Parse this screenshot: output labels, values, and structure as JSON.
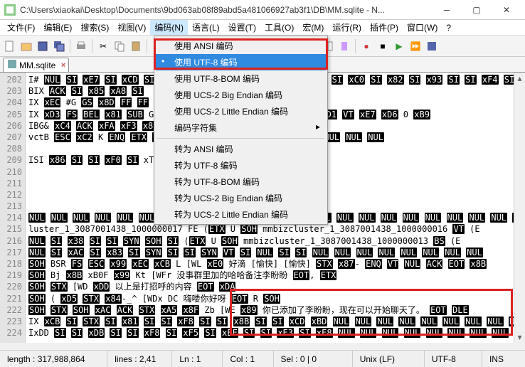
{
  "window": {
    "title": "C:\\Users\\xiaokai\\Desktop\\Documents\\9bd063ab08f89abd5a481066927ab3f1\\DB\\MM.sqlite - N..."
  },
  "menubar": {
    "items": [
      {
        "label": "文件(F)"
      },
      {
        "label": "编辑(E)"
      },
      {
        "label": "搜索(S)"
      },
      {
        "label": "视图(V)"
      },
      {
        "label": "编码(N)"
      },
      {
        "label": "语言(L)"
      },
      {
        "label": "设置(T)"
      },
      {
        "label": "工具(O)"
      },
      {
        "label": "宏(M)"
      },
      {
        "label": "运行(R)"
      },
      {
        "label": "插件(P)"
      },
      {
        "label": "窗口(W)"
      },
      {
        "label": "?"
      }
    ],
    "active_index": 4
  },
  "tab": {
    "label": "MM.sqlite"
  },
  "dropdown": {
    "groups": [
      [
        {
          "label": "使用 ANSI 编码"
        },
        {
          "label": "使用 UTF-8 编码",
          "selected": true,
          "bullet": true
        },
        {
          "label": "使用 UTF-8-BOM 编码"
        },
        {
          "label": "使用 UCS-2 Big Endian 编码"
        },
        {
          "label": "使用 UCS-2 Little Endian 编码"
        },
        {
          "label": "编码字符集",
          "submenu": true
        }
      ],
      [
        {
          "label": "转为 ANSI 编码"
        },
        {
          "label": "转为 UTF-8 编码"
        },
        {
          "label": "转为 UTF-8-BOM 编码"
        },
        {
          "label": "转为 UCS-2 Big Endian 编码"
        },
        {
          "label": "转为 UCS-2 Little Endian 编码"
        }
      ]
    ]
  },
  "gutter": {
    "start": 202,
    "end": 224
  },
  "code_lines": [
    "I# NUL SI xE7 SI xCD SI xE5 SI NUL NUL ETX NUL NUL NUL SI xC0 SI x82 SI x93 SI SI xF4 SI SI",
    "BIX ACK SI x85 xA8 SI                                              ",
    "IX xEC #G GS x8D FF FF ETB                                     ETX ACK SOH M% xF0 OPv xC1x",
    "IX xD3 FS BEL x81 SUB G                                    NUL FB FS FETX ETX ACK SOH Xi xD1 VT xE7 xD6 0 xB9",
    "IBG& xC4 ACK xFA xF3 x8D                                                                  ",
    "   vctB ESC xC2 K ENQ                                        ETX NUL NUL SI xFB NUL NUL NUL NUL NUL NUL NUL",
    "",
    "ISI x86 SI SI xF0 SI xTZ                                                                  ",
    "",
    "",
    "",
    "",
    "NUL NUL NUL NUL NUL NUL NUL NUL NUL NUL NUL NUL NUL NUL NUL NUL NUL NUL NUL NUL NUL NUL NUL NUL NUL NUL NUL",
    "luster_1_3087001438_1000000017 FE (ETX U SOH mmbizcluster_1_3087001438_1000000016 VT (E",
    "NUL SI x38 SI SI SYN SOH SI     (ETX U SOH mmbizcluster_1_3087001438_1000000013 BS (E",
    "NUL SI xAC SI x83 SI SYN SI SI SYN VT SI            NUL SI SI NUL NUL NUL NUL NUL NUL NUL NUL",
    "SOH        BSR FS ESC x99 xEC xCB L [WL xE0 好滴 [愉快] [愉快]  STX x87- ENQ VT     NUL ACK EOT x8B",
    "SOH           Bj x8B xB0F x99 Kt [WFr 没事群里加的哈哈备注李盼盼 EOT, ETX",
    "SOH   STX [WD xDD 以上是打招呼的内容 EOT xDA                                    ",
    "SOH         ( xD5 STX x84-_^ [WDx DC 嗨喽你好呀 EOT R SOH                        ",
    "SOH   STX SOH xAC ACK STX xA5 x8F Zb [WE x89 你已添加了李盼盼，现在可以开始聊天了。 EOT  DLE",
    "IX xCB SI STX SI x81 SI SI xF8 SI SI x8B SI SI xCD xBD NUL NUL NUL NUL NUL NUL NUL NUL NUL NUL NUL NUL NUL NUL NUL",
    "IxDD SI SI xDB SI SI xF8 SI xF5 SI xEF SI SI xE3 SI   xE8 NUL NUL NUL NUL NUL NUL NUL NUL NUL NUL NUL NUL NUL NUL NUL NUL"
  ],
  "statusbar": {
    "length": "length : 317,988,864",
    "lines": "lines : 2,41",
    "ln": "Ln : 1",
    "col": "Col : 1",
    "sel": "Sel : 0 | 0",
    "eol": "Unix (LF)",
    "enc": "UTF-8",
    "ins": "INS"
  }
}
